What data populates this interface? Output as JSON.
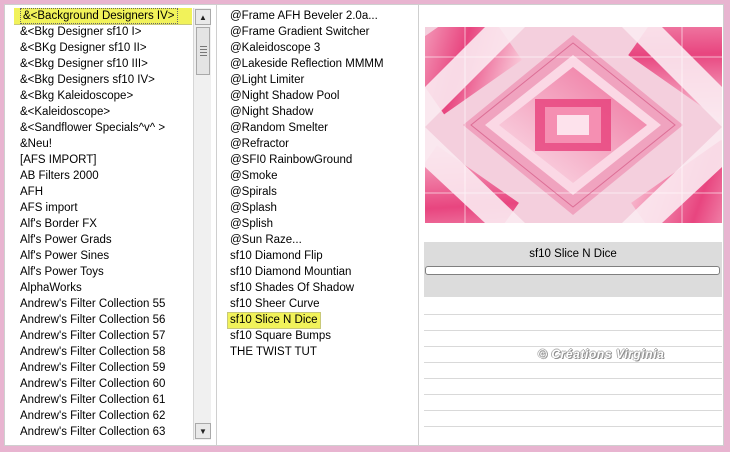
{
  "categories": {
    "items": [
      "&<Background Designers IV>",
      "&<Bkg Designer sf10 I>",
      "&<BKg Designer sf10 II>",
      "&<Bkg Designer sf10 III>",
      "&<Bkg Designers sf10 IV>",
      "&<Bkg Kaleidoscope>",
      "&<Kaleidoscope>",
      "&<Sandflower Specials^v^ >",
      "&Neu!",
      "[AFS IMPORT]",
      "AB Filters 2000",
      "AFH",
      "AFS import",
      "Alf's Border FX",
      "Alf's Power Grads",
      "Alf's Power Sines",
      "Alf's Power Toys",
      "AlphaWorks",
      "Andrew's Filter Collection 55",
      "Andrew's Filter Collection 56",
      "Andrew's Filter Collection 57",
      "Andrew's Filter Collection 58",
      "Andrew's Filter Collection 59",
      "Andrew's Filter Collection 60",
      "Andrew's Filter Collection 61",
      "Andrew's Filter Collection 62",
      "Andrew's Filter Collection 63"
    ],
    "selected_index": 0
  },
  "filters": {
    "items": [
      "@Frame AFH Beveler 2.0a...",
      "@Frame Gradient Switcher",
      "@Kaleidoscope 3",
      "@Lakeside Reflection MMMM",
      "@Light Limiter",
      "@Night Shadow Pool",
      "@Night Shadow",
      "@Random Smelter",
      "@Refractor",
      "@SFI0 RainbowGround",
      "@Smoke",
      "@Spirals",
      "@Splash",
      "@Splish",
      "@Sun Raze...",
      "sf10 Diamond Flip",
      "sf10 Diamond Mountian",
      "sf10 Shades Of Shadow",
      "sf10 Sheer Curve",
      "sf10 Slice N Dice",
      "sf10 Square Bumps",
      "THE TWIST TUT"
    ],
    "selected_index": 19
  },
  "preview": {
    "filter_name": "sf10 Slice N Dice",
    "watermark": "© Créations Virginia"
  },
  "scrollbar": {
    "up_icon": "▲",
    "down_icon": "▼"
  },
  "colors": {
    "highlight": "#f1f25a",
    "preview_pink": "#e8457f",
    "background": "#e8b4d0"
  }
}
